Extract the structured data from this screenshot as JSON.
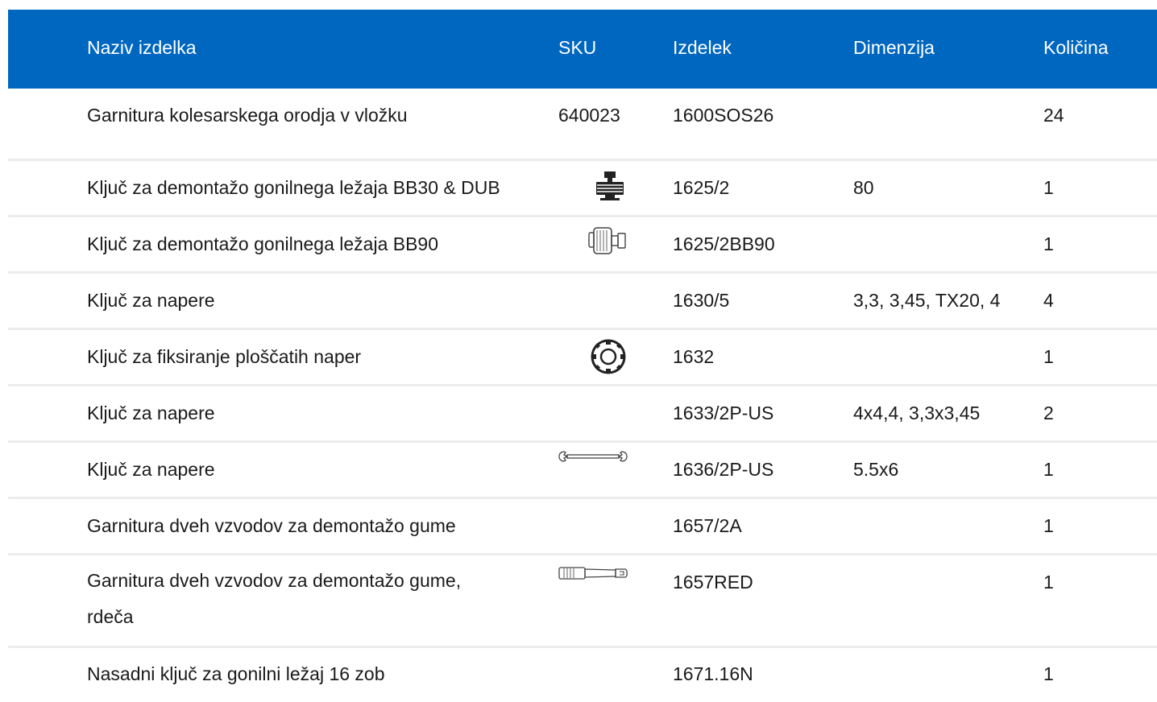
{
  "table": {
    "headers": {
      "name": "Naziv izdelka",
      "sku": "SKU",
      "item": "Izdelek",
      "dimension": "Dimenzija",
      "quantity": "Količina"
    },
    "rows": [
      {
        "name": "Garnitura kolesarskega orodja v vložku",
        "sku": "640023",
        "icon": "",
        "item": "1600SOS26",
        "dimension": "",
        "quantity": "24"
      },
      {
        "name": "Ključ za demontažo gonilnega ležaja BB30 & DUB",
        "sku": "",
        "icon": "bottom-bracket-tool-icon",
        "item": "1625/2",
        "dimension": "80",
        "quantity": "1"
      },
      {
        "name": "Ključ za demontažo gonilnega ležaja BB90",
        "sku": "",
        "icon": "bb90-tool-icon",
        "item": "1625/2BB90",
        "dimension": "",
        "quantity": "1"
      },
      {
        "name": "Ključ za napere",
        "sku": "",
        "icon": "",
        "item": "1630/5",
        "dimension": "3,3, 3,45, TX20, 4",
        "quantity": "4"
      },
      {
        "name": "Ključ za fiksiranje ploščatih naper",
        "sku": "",
        "icon": "flat-spoke-holder-icon",
        "item": "1632",
        "dimension": "",
        "quantity": "1"
      },
      {
        "name": "Ključ za napere",
        "sku": "",
        "icon": "",
        "item": "1633/2P-US",
        "dimension": "4x4,4, 3,3x3,45",
        "quantity": "2"
      },
      {
        "name": "Ključ za napere",
        "sku": "",
        "icon": "double-spoke-wrench-icon",
        "item": "1636/2P-US",
        "dimension": "5.5x6",
        "quantity": "1"
      },
      {
        "name": "Garnitura dveh vzvodov za demontažo gume",
        "sku": "",
        "icon": "",
        "item": "1657/2A",
        "dimension": "",
        "quantity": "1"
      },
      {
        "name": "Garnitura dveh vzvodov za demontažo gume, rdeča",
        "sku": "",
        "icon": "tire-lever-icon",
        "item": "1657RED",
        "dimension": "",
        "quantity": "1"
      },
      {
        "name": "Nasadni ključ za gonilni ležaj 16 zob",
        "sku": "",
        "icon": "",
        "item": "1671.16N",
        "dimension": "",
        "quantity": "1"
      }
    ]
  }
}
